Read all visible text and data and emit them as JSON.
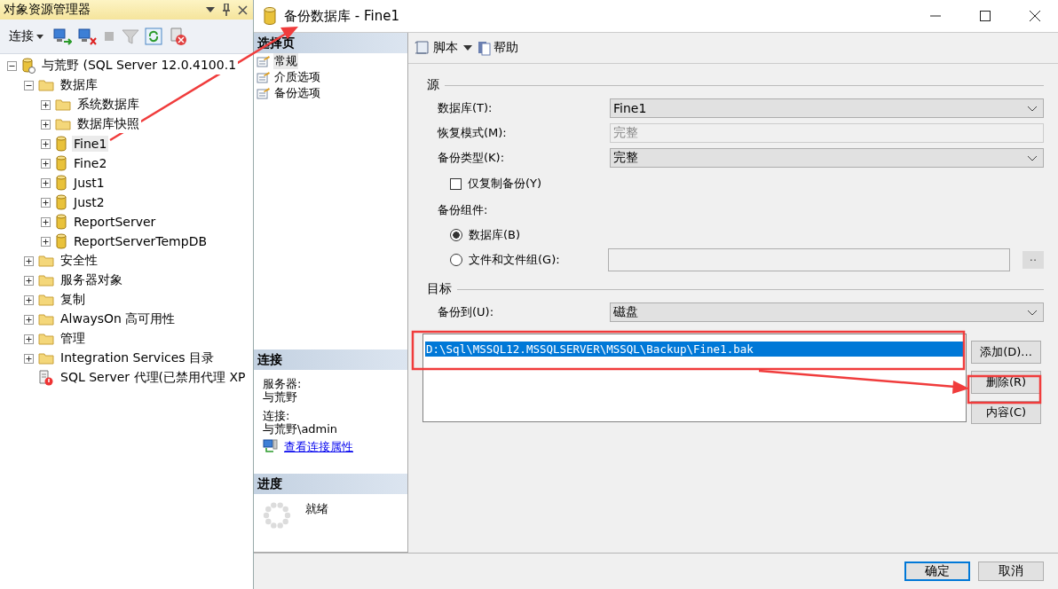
{
  "explorer": {
    "title": "对象资源管理器",
    "connect": "连接",
    "tree": [
      {
        "label": "与荒野 (SQL Server 12.0.4100.1",
        "kind": "server",
        "expanded": true,
        "selected": false,
        "children": [
          {
            "label": "数据库",
            "kind": "folder",
            "expanded": true,
            "selected": false,
            "children": [
              {
                "label": "系统数据库",
                "kind": "folder",
                "expanded": false,
                "selected": false
              },
              {
                "label": "数据库快照",
                "kind": "folder",
                "expanded": false,
                "selected": false
              },
              {
                "label": "Fine1",
                "kind": "database",
                "expanded": false,
                "selected": true
              },
              {
                "label": "Fine2",
                "kind": "database",
                "expanded": false,
                "selected": false
              },
              {
                "label": "Just1",
                "kind": "database",
                "expanded": false,
                "selected": false
              },
              {
                "label": "Just2",
                "kind": "database",
                "expanded": false,
                "selected": false
              },
              {
                "label": "ReportServer",
                "kind": "database",
                "expanded": false,
                "selected": false
              },
              {
                "label": "ReportServerTempDB",
                "kind": "database",
                "expanded": false,
                "selected": false
              }
            ]
          },
          {
            "label": "安全性",
            "kind": "folder",
            "expanded": false,
            "selected": false
          },
          {
            "label": "服务器对象",
            "kind": "folder",
            "expanded": false,
            "selected": false
          },
          {
            "label": "复制",
            "kind": "folder",
            "expanded": false,
            "selected": false
          },
          {
            "label": "AlwaysOn 高可用性",
            "kind": "folder",
            "expanded": false,
            "selected": false
          },
          {
            "label": "管理",
            "kind": "folder",
            "expanded": false,
            "selected": false
          },
          {
            "label": "Integration Services 目录",
            "kind": "folder",
            "expanded": false,
            "selected": false
          },
          {
            "label": "SQL Server 代理(已禁用代理 XP",
            "kind": "agent",
            "selected": false
          }
        ]
      }
    ]
  },
  "dialog": {
    "title": "备份数据库 - Fine1",
    "pages": {
      "header": "选择页",
      "items": [
        {
          "label": "常规",
          "selected": true
        },
        {
          "label": "介质选项",
          "selected": false
        },
        {
          "label": "备份选项",
          "selected": false
        }
      ]
    },
    "connection": {
      "header": "连接",
      "server_label": "服务器:",
      "server": "与荒野",
      "connection_label": "连接:",
      "connection": "与荒野\\admin",
      "link": "查看连接属性"
    },
    "progress": {
      "header": "进度",
      "status": "就绪"
    },
    "toolbar": {
      "script": "脚本",
      "help": "帮助"
    },
    "source": {
      "heading": "源",
      "fields": [
        {
          "label": "数据库(T):",
          "value": "Fine1",
          "disabled": false
        },
        {
          "label": "恢复模式(M):",
          "value": "完整",
          "disabled": true
        },
        {
          "label": "备份类型(K):",
          "value": "完整",
          "disabled": false
        }
      ],
      "copy_only": {
        "label": "仅复制备份(Y)",
        "checked": false
      },
      "components_label": "备份组件:",
      "components": [
        {
          "label": "数据库(B)",
          "selected": true
        },
        {
          "label": "文件和文件组(G):",
          "selected": false
        }
      ],
      "browse_button": "··"
    },
    "destination": {
      "heading": "目标",
      "label": "备份到(U):",
      "value": "磁盘",
      "files": [
        {
          "path": "D:\\Sql\\MSSQL12.MSSQLSERVER\\MSSQL\\Backup\\Fine1.bak",
          "selected": true
        }
      ],
      "buttons": [
        "添加(D)...",
        "删除(R)",
        "内容(C)"
      ]
    },
    "footer_buttons": [
      {
        "label": "确定",
        "default": true
      },
      {
        "label": "取消",
        "default": false
      }
    ]
  }
}
